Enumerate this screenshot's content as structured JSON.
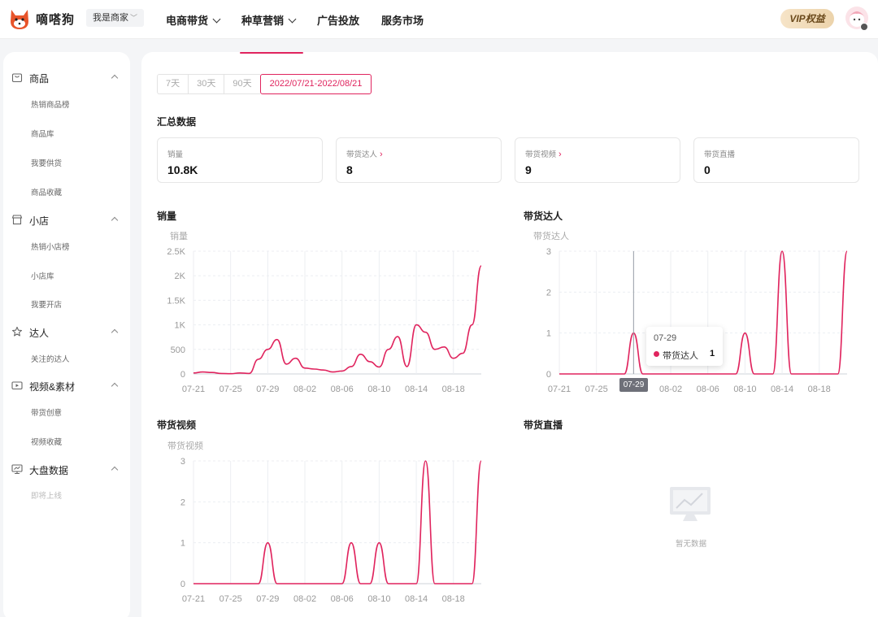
{
  "brand": {
    "name": "嘀嗒狗",
    "accent": "#e0245e"
  },
  "topbar": {
    "role_select": "我是商家",
    "nav": [
      {
        "label": "电商带货",
        "has_dropdown": true
      },
      {
        "label": "种草营销",
        "has_dropdown": true
      },
      {
        "label": "广告投放",
        "has_dropdown": false
      },
      {
        "label": "服务市场",
        "has_dropdown": false
      }
    ],
    "vip_label": "VIP权益"
  },
  "sidebar": {
    "groups": [
      {
        "label": "商品",
        "icon": "bag-icon",
        "items": [
          "热销商品榜",
          "商品库",
          "我要供货",
          "商品收藏"
        ]
      },
      {
        "label": "小店",
        "icon": "store-icon",
        "items": [
          "热销小店榜",
          "小店库",
          "我要开店"
        ]
      },
      {
        "label": "达人",
        "icon": "star-icon",
        "items": [
          "关注的达人"
        ]
      },
      {
        "label": "视频&素材",
        "icon": "video-icon",
        "items": [
          "带货创意",
          "视频收藏"
        ]
      },
      {
        "label": "大盘数据",
        "icon": "monitor-icon",
        "items": [
          "即将上线"
        ]
      }
    ]
  },
  "date_range": {
    "options": [
      "7天",
      "30天",
      "90天",
      "2022/07/21-2022/08/21"
    ],
    "selected": "2022/07/21-2022/08/21"
  },
  "summary": {
    "title": "汇总数据",
    "cards": [
      {
        "label": "销量",
        "value": "10.8K",
        "link": false
      },
      {
        "label": "带货达人",
        "value": "8",
        "link": true
      },
      {
        "label": "带货视频",
        "value": "9",
        "link": true
      },
      {
        "label": "带货直播",
        "value": "0",
        "link": false
      }
    ]
  },
  "x_ticks": [
    "07-21",
    "07-25",
    "07-29",
    "08-02",
    "08-06",
    "08-10",
    "08-14",
    "08-18"
  ],
  "chart_data": [
    {
      "type": "line",
      "title": "销量",
      "ylabel": "销量",
      "ylim": [
        0,
        2500
      ],
      "y_ticks": [
        "0",
        "500",
        "1K",
        "1.5K",
        "2K",
        "2.5K"
      ],
      "grid": true,
      "x": [
        "07-21",
        "07-22",
        "07-23",
        "07-24",
        "07-25",
        "07-26",
        "07-27",
        "07-28",
        "07-29",
        "07-30",
        "07-31",
        "08-01",
        "08-02",
        "08-03",
        "08-04",
        "08-05",
        "08-06",
        "08-07",
        "08-08",
        "08-09",
        "08-10",
        "08-11",
        "08-12",
        "08-13",
        "08-14",
        "08-15",
        "08-16",
        "08-17",
        "08-18",
        "08-19",
        "08-20",
        "08-21"
      ],
      "series": [
        {
          "values": [
            20,
            40,
            30,
            10,
            5,
            20,
            10,
            300,
            500,
            700,
            200,
            320,
            120,
            100,
            80,
            40,
            60,
            150,
            400,
            250,
            140,
            500,
            760,
            150,
            1000,
            850,
            500,
            550,
            320,
            420,
            1000,
            2200
          ]
        }
      ]
    },
    {
      "type": "line",
      "title": "带货达人",
      "ylabel": "带货达人",
      "ylim": [
        0,
        3
      ],
      "y_ticks": [
        "0",
        "1",
        "2",
        "3"
      ],
      "grid": true,
      "x": [
        "07-21",
        "07-22",
        "07-23",
        "07-24",
        "07-25",
        "07-26",
        "07-27",
        "07-28",
        "07-29",
        "07-30",
        "07-31",
        "08-01",
        "08-02",
        "08-03",
        "08-04",
        "08-05",
        "08-06",
        "08-07",
        "08-08",
        "08-09",
        "08-10",
        "08-11",
        "08-12",
        "08-13",
        "08-14",
        "08-15",
        "08-16",
        "08-17",
        "08-18",
        "08-19",
        "08-20",
        "08-21"
      ],
      "series": [
        {
          "values": [
            0,
            0,
            0,
            0,
            0,
            0,
            0,
            0,
            1,
            0,
            0,
            0,
            0,
            0,
            0,
            0,
            0,
            0,
            0,
            0,
            1,
            0,
            0,
            0,
            3,
            0,
            0,
            0,
            0,
            0,
            0,
            3
          ]
        }
      ],
      "tooltip": {
        "date": "07-29",
        "series": "带货达人",
        "value": "1"
      }
    },
    {
      "type": "line",
      "title": "带货视频",
      "ylabel": "带货视频",
      "ylim": [
        0,
        3
      ],
      "y_ticks": [
        "0",
        "1",
        "2",
        "3"
      ],
      "grid": true,
      "x": [
        "07-21",
        "07-22",
        "07-23",
        "07-24",
        "07-25",
        "07-26",
        "07-27",
        "07-28",
        "07-29",
        "07-30",
        "07-31",
        "08-01",
        "08-02",
        "08-03",
        "08-04",
        "08-05",
        "08-06",
        "08-07",
        "08-08",
        "08-09",
        "08-10",
        "08-11",
        "08-12",
        "08-13",
        "08-14",
        "08-15",
        "08-16",
        "08-17",
        "08-18",
        "08-19",
        "08-20",
        "08-21"
      ],
      "series": [
        {
          "values": [
            0,
            0,
            0,
            0,
            0,
            0,
            0,
            0,
            1,
            0,
            0,
            0,
            0,
            0,
            0,
            0,
            0,
            1,
            0,
            0,
            1,
            0,
            0,
            0,
            0,
            3,
            0,
            0,
            0,
            0,
            0,
            3
          ]
        }
      ]
    },
    {
      "type": "line",
      "title": "带货直播",
      "empty_text": "暂无数据"
    }
  ]
}
